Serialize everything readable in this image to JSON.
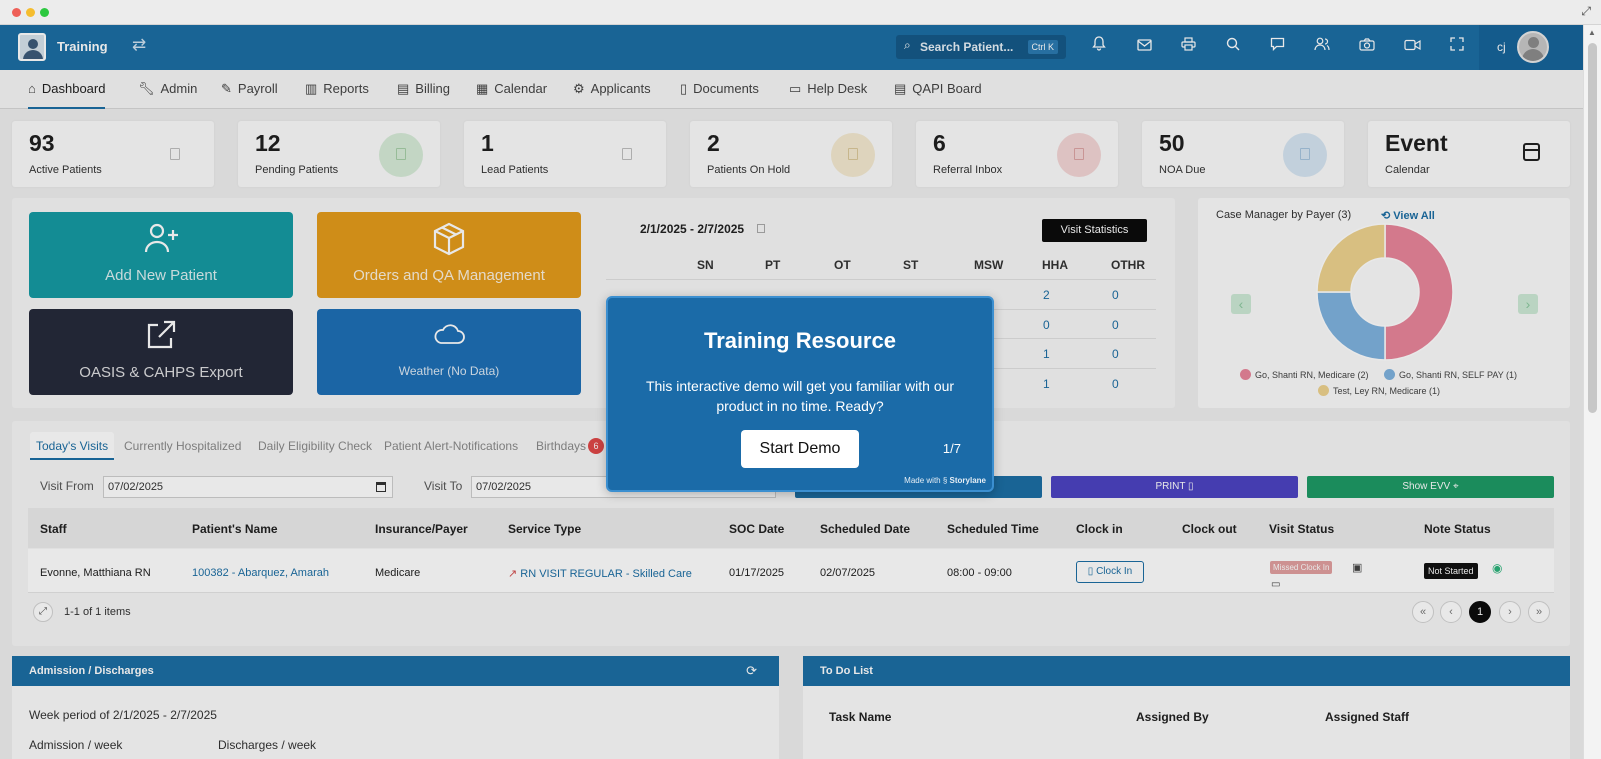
{
  "app": {
    "brand": "Training",
    "search_placeholder": "Search Patient...",
    "search_shortcut": "Ctrl K",
    "user_initials": "cj"
  },
  "nav": {
    "items": [
      {
        "label": "Dashboard",
        "icon": "home-icon"
      },
      {
        "label": "Admin",
        "icon": "wrench-icon"
      },
      {
        "label": "Payroll",
        "icon": "edit-icon"
      },
      {
        "label": "Reports",
        "icon": "bar-chart-icon"
      },
      {
        "label": "Billing",
        "icon": "clipboard-icon"
      },
      {
        "label": "Calendar",
        "icon": "calendar-icon"
      },
      {
        "label": "Applicants",
        "icon": "users-cog-icon"
      },
      {
        "label": "Documents",
        "icon": "document-icon"
      },
      {
        "label": "Help Desk",
        "icon": "ticket-icon"
      },
      {
        "label": "QAPI Board",
        "icon": "clipboard-list-icon"
      }
    ]
  },
  "stats": [
    {
      "value": "93",
      "label": "Active Patients"
    },
    {
      "value": "12",
      "label": "Pending Patients"
    },
    {
      "value": "1",
      "label": "Lead Patients"
    },
    {
      "value": "2",
      "label": "Patients On Hold"
    },
    {
      "value": "6",
      "label": "Referral Inbox"
    },
    {
      "value": "50",
      "label": "NOA Due"
    },
    {
      "value": "Event",
      "label": "Calendar"
    }
  ],
  "tiles": [
    {
      "label": "Add New Patient",
      "icon": "user-plus-icon"
    },
    {
      "label": "Orders and QA Management",
      "icon": "box-icon"
    },
    {
      "label": "OASIS & CAHPS Export",
      "icon": "external-link-icon"
    },
    {
      "label": "Weather (No Data)",
      "icon": "cloud-icon"
    }
  ],
  "visit_stats": {
    "dates": "2/1/2025 - 2/7/2025",
    "button": "Visit Statistics",
    "columns": [
      "SN",
      "PT",
      "OT",
      "ST",
      "MSW",
      "HHA",
      "OTHR"
    ],
    "hha": [
      "2",
      "0",
      "1",
      "1"
    ],
    "othr": [
      "0",
      "0",
      "0",
      "0"
    ]
  },
  "case_manager": {
    "title": "Case Manager by Payer",
    "count": "(3)",
    "view_all": "View All",
    "legend": [
      {
        "label": "Go, Shanti RN, Medicare (2)",
        "color": "#e8869a"
      },
      {
        "label": "Go, Shanti RN, SELF PAY  (1)",
        "color": "#7fb2de"
      },
      {
        "label": "Test, Ley RN, Medicare (1)",
        "color": "#eed28e"
      }
    ]
  },
  "visits": {
    "tabs": [
      {
        "label": "Today's Visits"
      },
      {
        "label": "Currently Hospitalized"
      },
      {
        "label": "Daily Eligibility Check"
      },
      {
        "label": "Patient Alert-Notifications"
      },
      {
        "label": "Birthdays",
        "badge": "6"
      }
    ],
    "visit_from_label": "Visit From",
    "visit_from": "07/02/2025",
    "visit_to_label": "Visit To",
    "visit_to": "07/02/2025",
    "print_label": "PRINT",
    "evv_label": "Show EVV",
    "columns": [
      "Staff",
      "Patient's Name",
      "Insurance/Payer",
      "Service Type",
      "SOC Date",
      "Scheduled Date",
      "Scheduled Time",
      "Clock in",
      "Clock out",
      "Visit Status",
      "Note Status"
    ],
    "row": {
      "staff": "Evonne, Matthiana RN",
      "patient": "100382 - Abarquez, Amarah",
      "payer": "Medicare",
      "service": "RN VISIT REGULAR - Skilled Care",
      "soc": "01/17/2025",
      "scheduled_date": "02/07/2025",
      "scheduled_time": "08:00 - 09:00",
      "clock_in_btn": "Clock In",
      "visit_status": "Missed Clock In",
      "note_status": "Not Started"
    },
    "pager_text": "1-1 of 1 items",
    "page": "1"
  },
  "admission": {
    "title": "Admission / Discharges",
    "period": "Week period of 2/1/2025 - 2/7/2025",
    "admission_label": "Admission / week",
    "discharge_label": "Discharges / week"
  },
  "todo": {
    "title": "To Do List",
    "columns": [
      "Task Name",
      "Assigned By",
      "Assigned Staff"
    ]
  },
  "modal": {
    "title": "Training Resource",
    "body": "This interactive demo will get you familiar with our product in no time. Ready?",
    "button": "Start Demo",
    "step": "1/7",
    "made_with": "Made with",
    "made_with_brand": "Storylane"
  },
  "colors": {
    "primary": "#1c6ea4",
    "teal_tile": "#159aa3",
    "orange_tile": "#e49b1b",
    "dark_tile": "#262a3b",
    "blue_tile": "#1e6fb6",
    "print_btn": "#4c44c2",
    "evv_btn": "#1e9a66"
  }
}
